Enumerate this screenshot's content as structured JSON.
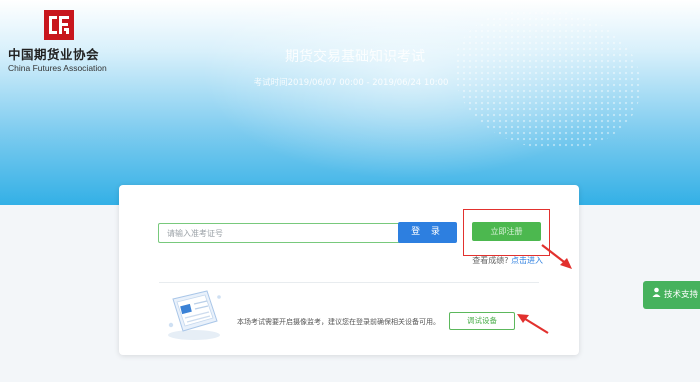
{
  "logo": {
    "name_cn": "中国期货业协会",
    "name_en": "China Futures Association",
    "brand_color": "#c8161d",
    "icon": "cfa-logo-icon"
  },
  "hero": {
    "title": "期货交易基础知识考试",
    "subtitle": "考试时间2019/06/07 00:00 - 2019/06/24 10:00"
  },
  "login": {
    "input_placeholder": "请输入准考证号",
    "login_label": "登 录",
    "register_label": "立即注册",
    "score_question": "查看成绩?",
    "score_link": "点击进入"
  },
  "device": {
    "notice": "本场考试需要开启摄像监考，建议您在登录前确保相关设备可用。",
    "test_button": "调试设备",
    "illustration_icon": "device-illustration-icon"
  },
  "support": {
    "label": "技术支持",
    "icon": "support-person-icon"
  },
  "colors": {
    "accent_blue": "#2d7fe0",
    "accent_green": "#4cb84f",
    "highlight_red": "#e2312e"
  }
}
